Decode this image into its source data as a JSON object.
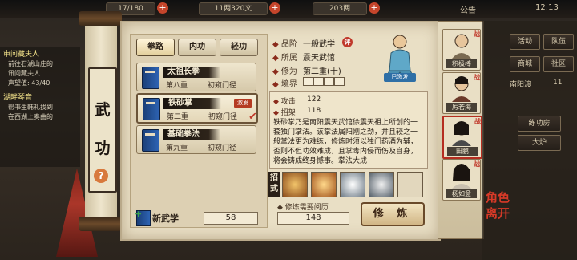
{
  "topbar": {
    "stamina": "17/180",
    "money": "11两320文",
    "gold": "203两",
    "announce": "公告",
    "time": "12:13"
  },
  "quests": [
    {
      "title": "审问藏夫人",
      "lines": [
        "前往石湖山庄的",
        "讯问藏夫人",
        "声望值: 43/40"
      ]
    },
    {
      "title": "湖畔琴音",
      "lines": [
        "帮书生韩礼找到",
        "在西湖上奏曲的"
      ]
    }
  ],
  "scroll_title": [
    "武",
    "功"
  ],
  "tabs": [
    "拳路",
    "内功",
    "轻功"
  ],
  "skills": [
    {
      "name": "太祖长拳",
      "level": "第八重",
      "rank": "初窥门径",
      "badge": ""
    },
    {
      "name": "铁砂掌",
      "level": "第二重",
      "rank": "初窥门径",
      "badge": "激发"
    },
    {
      "name": "基础拳法",
      "level": "第九重",
      "rank": "初窥门径",
      "badge": ""
    }
  ],
  "new_skill": {
    "label": "新武学",
    "points": "58"
  },
  "detail": {
    "grade_label": "品阶",
    "grade_value": "一般武学",
    "grade_icon": "评",
    "faction_label": "所属",
    "faction_value": "震天武馆",
    "cultivation_label": "修为",
    "cultivation_value": "第二重(十)",
    "realm_label": "境界",
    "master_tag": "已激发",
    "attack_label": "攻击",
    "attack_value": "122",
    "parry_label": "招架",
    "parry_value": "118",
    "description": "铁砂掌乃是南阳震天武馆徐震天祖上所创的一套独门掌法。该掌法属阳刚之劲，并且较之一般掌法更为难练，修炼时须以独门药酒为辅，否则不但功效难成，且掌毒内侵而伤及自身，将会铸成终身憾事。掌法大成",
    "moves_label": "招式",
    "cost_label": "修炼需要阅历",
    "cost_value": "148",
    "train_button": "修 炼"
  },
  "characters": [
    {
      "name": "积极棒",
      "tag": "战"
    },
    {
      "name": "厉若海",
      "tag": "战"
    },
    {
      "name": "田鹏",
      "tag": "战"
    },
    {
      "name": "杨如意",
      "tag": "战"
    }
  ],
  "menu": {
    "row1": [
      "活动",
      "队伍"
    ],
    "row2": [
      "商城",
      "社区"
    ],
    "row3": [
      "南阳渡",
      "11"
    ],
    "practice": "练功房",
    "stove": "大炉"
  },
  "role_leave": [
    "角色",
    "离开"
  ],
  "colors": {
    "accent_red": "#c0392b",
    "paper": "#e9dfc5",
    "book_blue": "#2d63b3"
  }
}
